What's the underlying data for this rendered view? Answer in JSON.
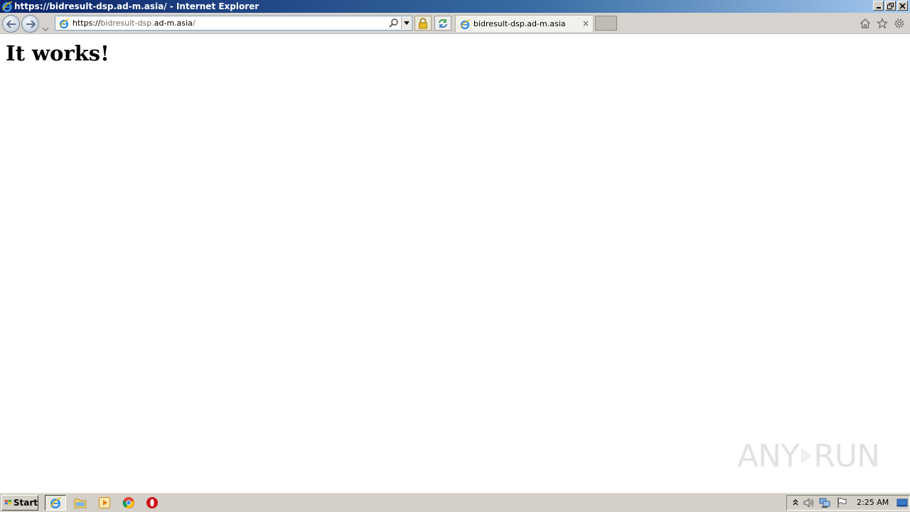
{
  "window": {
    "title": "https://bidresult-dsp.ad-m.asia/ - Internet Explorer",
    "controls": [
      "minimize",
      "restore",
      "close"
    ]
  },
  "navbar": {
    "address": {
      "scheme": "https://",
      "host_dim": "bidresult-dsp.",
      "host_main": "ad-m.asia",
      "path": "/"
    },
    "tab": {
      "title": "bidresult-dsp.ad-m.asia",
      "close_glyph": "×"
    },
    "icons": [
      "back-icon",
      "forward-icon",
      "history-dropdown-icon",
      "search-icon",
      "lock-icon",
      "compat-refresh-icon",
      "home-icon",
      "favorites-icon",
      "tools-icon"
    ]
  },
  "content": {
    "heading": "It works!"
  },
  "watermark": {
    "left_text": "ANY",
    "right_text": "RUN"
  },
  "taskbar": {
    "start_label": "Start",
    "apps": [
      "internet-explorer-icon",
      "explorer-folder-icon",
      "media-player-icon",
      "chrome-icon",
      "opera-icon"
    ],
    "tray_icons": [
      "show-hidden-icon",
      "volume-icon",
      "network-icon",
      "action-center-flag-icon"
    ],
    "clock": "2:25 AM"
  }
}
